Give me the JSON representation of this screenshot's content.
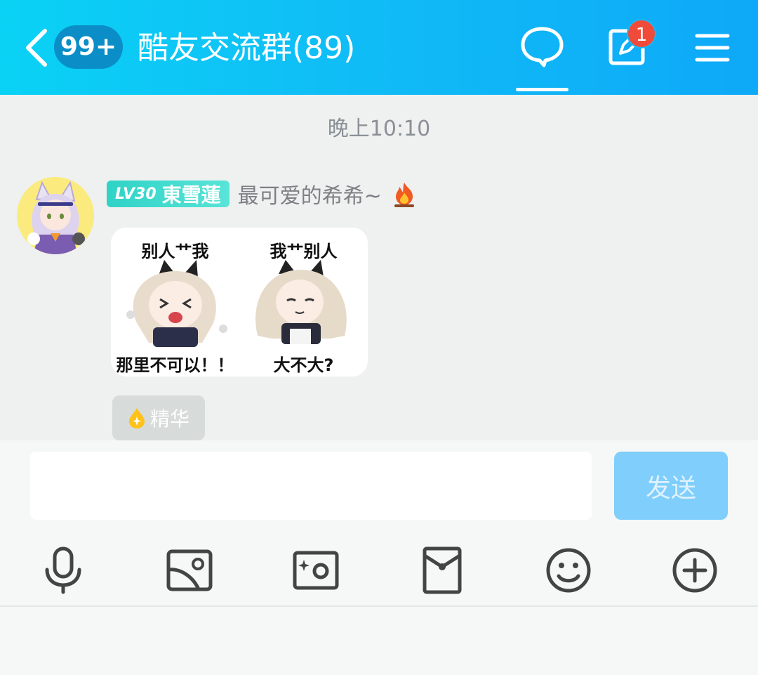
{
  "header": {
    "unread_count": "99+",
    "group_title": "酷友交流群(89)",
    "notification_count": "1"
  },
  "chat": {
    "timestamp": "晚上10:10",
    "message": {
      "level": "LV30",
      "nickname": "東雪蓮",
      "member_title": "最可爱的希希~",
      "sticker": {
        "left_top": "别人艹我",
        "left_bottom": "那里不可以！！",
        "right_top": "我艹别人",
        "right_bottom": "大不大?"
      },
      "essence_label": "精华"
    }
  },
  "input": {
    "value": "",
    "placeholder": "",
    "send_label": "发送"
  },
  "toolbar": {
    "icons": [
      "microphone-icon",
      "image-icon",
      "camera-icon",
      "red-packet-icon",
      "emoji-icon",
      "plus-icon"
    ]
  },
  "colors": {
    "header_start": "#0ad2f5",
    "header_end": "#0ea9f8",
    "badge_red": "#f04b3a",
    "level_tag": "#2fd3c6",
    "send_button": "#7fcefc"
  }
}
